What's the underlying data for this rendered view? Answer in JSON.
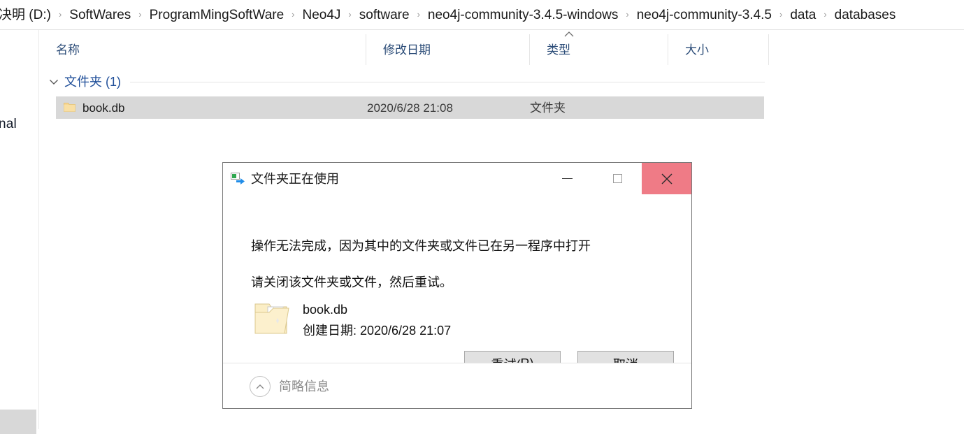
{
  "explorer": {
    "breadcrumb": {
      "separator": "›",
      "items": [
        "决明 (D:)",
        "SoftWares",
        "ProgramMingSoftWare",
        "Neo4J",
        "software",
        "neo4j-community-3.4.5-windows",
        "neo4j-community-3.4.5",
        "data",
        "databases"
      ]
    },
    "nav_pane": {
      "clipped_label": "nal"
    },
    "columns": [
      {
        "label": "名称",
        "name": "name"
      },
      {
        "label": "修改日期",
        "name": "date-modified"
      },
      {
        "label": "类型",
        "name": "type"
      },
      {
        "label": "大小",
        "name": "size"
      }
    ],
    "sort": {
      "column": "类型",
      "direction": "ascending"
    },
    "group": {
      "title": "文件夹 (1)",
      "expanded": true
    },
    "rows": [
      {
        "name": "book.db",
        "date_modified": "2020/6/28 21:08",
        "type": "文件夹",
        "size": "",
        "selected": true,
        "icon": "folder-icon"
      }
    ]
  },
  "dialog": {
    "title": "文件夹正在使用",
    "title_icon": "move-items-icon",
    "window_controls": {
      "minimize": "—",
      "maximize": "□",
      "close": "✕",
      "close_bg": "#ef7b86"
    },
    "message_line1": "操作无法完成，因为其中的文件夹或文件已在另一程序中打开",
    "message_line2": "请关闭该文件夹或文件，然后重试。",
    "file_info": {
      "icon": "open-folder-icon",
      "name": "book.db",
      "created": "创建日期: 2020/6/28 21:07"
    },
    "buttons": {
      "retry_prefix": "重试(",
      "retry_accel": "R",
      "retry_suffix": ")",
      "cancel": "取消"
    },
    "footer": {
      "toggle_label": "简略信息",
      "toggle_icon": "chevron-up-circle-icon"
    }
  }
}
